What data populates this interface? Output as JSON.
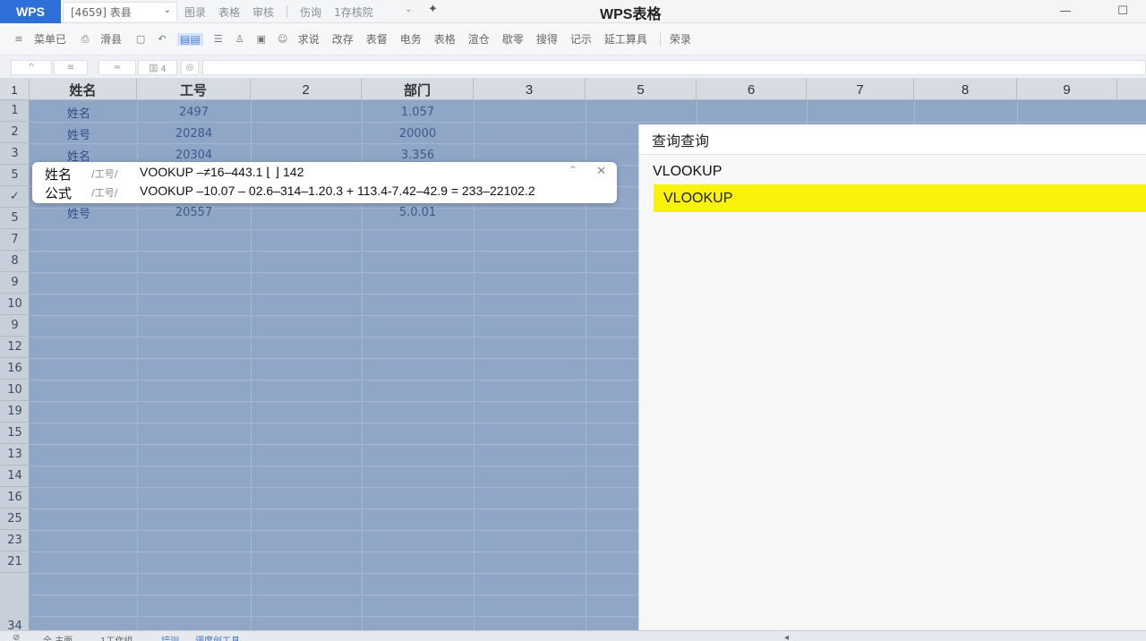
{
  "titlebar": {
    "logo": "WPS",
    "doc_tab": "[4659] 表县",
    "menus": [
      "图录",
      "表格",
      "审核"
    ],
    "menus2": [
      "伤询",
      "1存核院"
    ],
    "app_title": "WPS表格"
  },
  "toolbar": {
    "items": [
      "菜单已",
      "滑县",
      "求说",
      "改存",
      "表督",
      "电务",
      "表格",
      "渲仓",
      "歇零",
      "搜得",
      "记示",
      "延工算具",
      "荣录"
    ]
  },
  "formula_row": {
    "cells": [
      "^",
      "≡",
      "≈",
      "国 4"
    ]
  },
  "grid": {
    "col_headers": [
      "1",
      "姓名",
      "工号",
      "2",
      "部门",
      "3",
      "5",
      "6",
      "7",
      "8",
      "9"
    ],
    "row_headers": [
      "1",
      "2",
      "3",
      "5",
      "✓",
      "5",
      "7",
      "8",
      "9",
      "10",
      "9",
      "12",
      "16",
      "10",
      "19",
      "15",
      "13",
      "14",
      "16",
      "25",
      "23",
      "21",
      "34"
    ],
    "rows": [
      {
        "name": "姓名",
        "id": "2497",
        "dept": "1.057"
      },
      {
        "name": "姓号",
        "id": "20284",
        "dept": "20000"
      },
      {
        "name": "姓名",
        "id": "20304",
        "dept": "3.356"
      },
      {
        "name": "",
        "id": "",
        "dept": ""
      },
      {
        "name": "",
        "id": "",
        "dept": ""
      },
      {
        "name": "姓号",
        "id": "20557",
        "dept": "5.0.01"
      }
    ]
  },
  "popup": {
    "label1": "姓名",
    "prefix1": "/工号/",
    "value1": "VOOKUP –≠16–443.1 ⌊ ⌋ 142",
    "label2": "公式",
    "prefix2": "/工号/",
    "value2": "VOOKUP –10.07 – 02.6–314–1.20.3 + 113.4-7.42–42.9 = 233–22102.2"
  },
  "panel": {
    "title": "查询查询",
    "query": "VLOOKUP",
    "result": "VLOOKUP"
  },
  "sheets": {
    "tabs": [
      "全 主面",
      "1工作组",
      "培训",
      "调度创工具"
    ]
  }
}
